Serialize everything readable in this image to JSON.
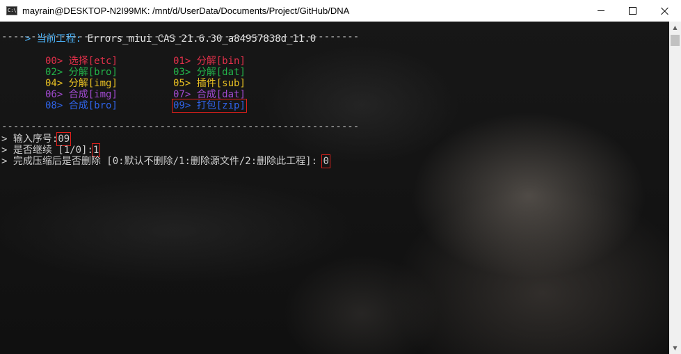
{
  "window": {
    "icon_label": "C:\\",
    "title": "mayrain@DESKTOP-N2I99MK: /mnt/d/UserData/Documents/Project/GitHub/DNA"
  },
  "terminal": {
    "prompt": ">",
    "project_label": "当前工程:",
    "project_name": "Errors_miui_CAS_21.6.30_a84957838d_11.0",
    "separator": "-------------------------------------------------------------",
    "menu_arrow": ">",
    "menu": [
      {
        "num": "00",
        "label": "选择[etc]",
        "color": "#e2304a"
      },
      {
        "num": "01",
        "label": "分解[bin]",
        "color": "#e2304a"
      },
      {
        "num": "02",
        "label": "分解[bro]",
        "color": "#23b34a"
      },
      {
        "num": "03",
        "label": "分解[dat]",
        "color": "#23b34a"
      },
      {
        "num": "04",
        "label": "分解[img]",
        "color": "#e8c023"
      },
      {
        "num": "05",
        "label": "插件[sub]",
        "color": "#e8c023"
      },
      {
        "num": "06",
        "label": "合成[img]",
        "color": "#a14ad0"
      },
      {
        "num": "07",
        "label": "合成[dat]",
        "color": "#a14ad0"
      },
      {
        "num": "08",
        "label": "合成[bro]",
        "color": "#2f63e8"
      },
      {
        "num": "09",
        "label": "打包[zip]",
        "color": "#2f63e8"
      }
    ],
    "inputs": [
      {
        "label": "输入序号:",
        "value": "09"
      },
      {
        "label": "是否继续 [1/0]:",
        "value": "1"
      },
      {
        "label": "完成压缩后是否删除 [0:默认不删除/1:删除源文件/2:删除此工程]:",
        "value": "0"
      }
    ]
  },
  "colors": {
    "highlight": "#4db8ff",
    "annotation_box": "#e0201b"
  },
  "scrollbar": {
    "up_arrow": "▲",
    "down_arrow": "▼"
  }
}
